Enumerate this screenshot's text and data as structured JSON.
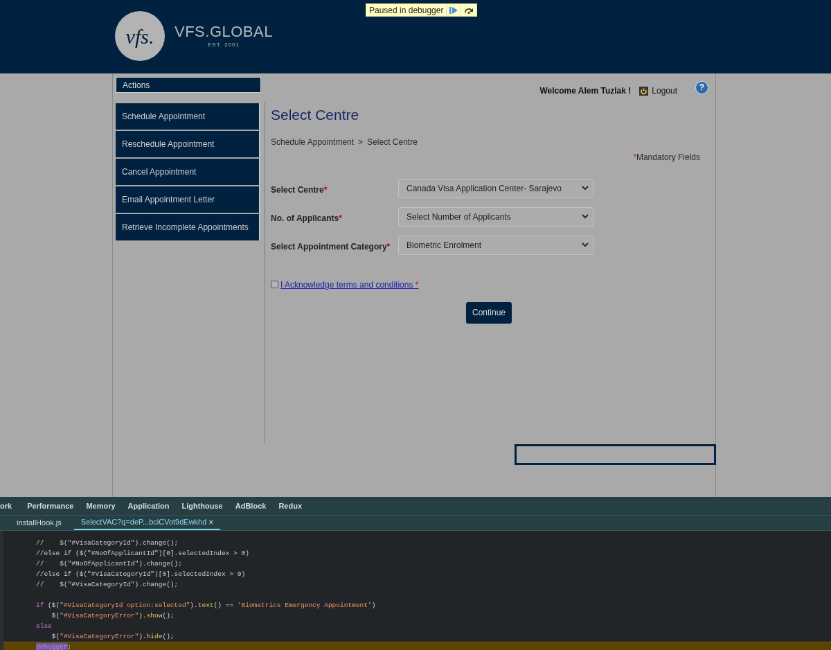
{
  "debugger_banner": {
    "text": "Paused in debugger"
  },
  "header": {
    "logo_mark": "vfs.",
    "brand": "VFS.GLOBAL",
    "established": "EST. 2001"
  },
  "sidebar": {
    "title": "Actions",
    "items": [
      {
        "label": "Schedule Appointment"
      },
      {
        "label": "Reschedule Appointment"
      },
      {
        "label": "Cancel Appointment"
      },
      {
        "label": "Email Appointment Letter"
      },
      {
        "label": "Retrieve Incomplete Appointments"
      }
    ]
  },
  "user_bar": {
    "welcome": "Welcome Alem Tuzlak !",
    "logout": "Logout",
    "help": "?"
  },
  "page": {
    "title": "Select Centre",
    "breadcrumb": [
      "Schedule Appointment",
      "Select Centre"
    ],
    "breadcrumb_separator": ">",
    "mandatory_mark": "*",
    "mandatory_note": "Mandatory Fields"
  },
  "form": {
    "fields": [
      {
        "label": "Select Centre",
        "required_mark": "*",
        "value": "Canada Visa Application Center- Sarajevo"
      },
      {
        "label": "No. of Applicants",
        "required_mark": "*",
        "value": "Select Number of Applicants"
      },
      {
        "label": "Select Appointment Category",
        "required_mark": "*",
        "value": "Biometric Enrolment"
      }
    ],
    "terms": {
      "label": "I Acknowledge terms and conditions ",
      "required_mark": "*",
      "checked": false
    },
    "submit": "Continue"
  },
  "devtools": {
    "panels": [
      {
        "label": "ork"
      },
      {
        "label": "Performance"
      },
      {
        "label": "Memory"
      },
      {
        "label": "Application"
      },
      {
        "label": "Lighthouse"
      },
      {
        "label": "AdBlock"
      },
      {
        "label": "Redux"
      }
    ],
    "files": [
      {
        "name": "installHook.js",
        "selected": false
      },
      {
        "name": "SelectVAC?q=deP...bciCVot9dEwkhd",
        "selected": true,
        "close": "×"
      }
    ],
    "code_lines": [
      {
        "highlighted": false,
        "tokens": [
          {
            "kind": "comment",
            "text": "//    $(\"#VisaCategoryId\").change();"
          }
        ]
      },
      {
        "highlighted": false,
        "tokens": [
          {
            "kind": "comment",
            "text": "//else if ($(\"#NoOfApplicantId\")[0].selectedIndex > 0)"
          }
        ]
      },
      {
        "highlighted": false,
        "tokens": [
          {
            "kind": "comment",
            "text": "//    $(\"#NoOfApplicantId\").change();"
          }
        ]
      },
      {
        "highlighted": false,
        "tokens": [
          {
            "kind": "comment",
            "text": "//else if ($(\"#VisaCategoryId\")[0].selectedIndex > 0)"
          }
        ]
      },
      {
        "highlighted": false,
        "tokens": [
          {
            "kind": "comment",
            "text": "//    $(\"#VisaCategoryId\").change();"
          }
        ]
      },
      {
        "highlighted": false
      },
      {
        "highlighted": false,
        "tokens": [
          {
            "kind": "keyword",
            "text": "if"
          },
          {
            "kind": "plain",
            "text": " ($("
          },
          {
            "kind": "string",
            "text": "\"#VisaCategoryId option:selected\""
          },
          {
            "kind": "plain",
            "text": ")."
          },
          {
            "kind": "method",
            "text": "text"
          },
          {
            "kind": "plain",
            "text": "() == "
          },
          {
            "kind": "string",
            "text": "'Biometrics Emergency Appointment'"
          },
          {
            "kind": "plain",
            "text": ")"
          }
        ]
      },
      {
        "highlighted": false,
        "tokens": [
          {
            "kind": "plain",
            "text": "    $("
          },
          {
            "kind": "string",
            "text": "\"#VisaCategoryError\""
          },
          {
            "kind": "plain",
            "text": ")."
          },
          {
            "kind": "method",
            "text": "show"
          },
          {
            "kind": "plain",
            "text": "();"
          }
        ]
      },
      {
        "highlighted": false,
        "tokens": [
          {
            "kind": "keyword",
            "text": "else"
          }
        ]
      },
      {
        "highlighted": false,
        "tokens": [
          {
            "kind": "plain",
            "text": "    $("
          },
          {
            "kind": "string",
            "text": "\"#VisaCategoryError\""
          },
          {
            "kind": "plain",
            "text": ")."
          },
          {
            "kind": "method",
            "text": "hide"
          },
          {
            "kind": "plain",
            "text": "();"
          }
        ]
      },
      {
        "highlighted": true,
        "tokens": [
          {
            "kind": "selection",
            "text": "debugger"
          },
          {
            "kind": "plain",
            "text": ";"
          }
        ]
      }
    ]
  }
}
